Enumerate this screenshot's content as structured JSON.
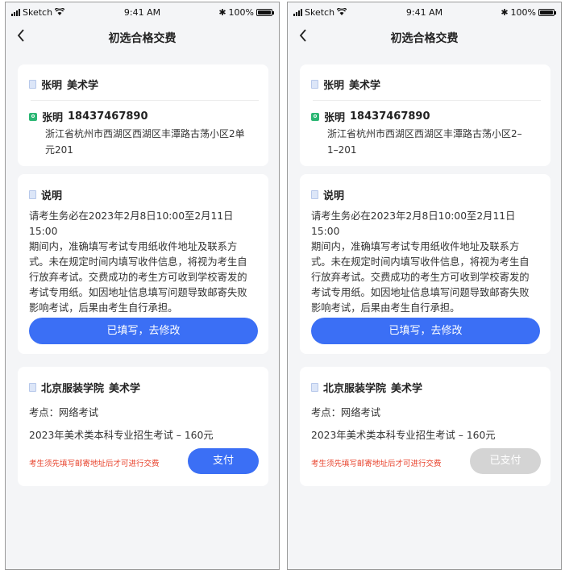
{
  "colors": {
    "accent": "#3b6ff5",
    "warning": "#e8452f",
    "disabled": "#d4d4d4"
  },
  "screens": [
    {
      "status": {
        "carrier": "Sketch",
        "time": "9:41 AM",
        "battery": "100%"
      },
      "nav": {
        "title": "初选合格交费"
      },
      "school_card": {
        "name": "张明",
        "major": "美术学"
      },
      "contact": {
        "name": "张明",
        "phone": "18437467890",
        "address_line1": "浙江省杭州市西湖区西湖区丰潭路古荡小区2单",
        "address_line2": "元201"
      },
      "notice": {
        "title": "说明",
        "lines": [
          "请考生务必在2023年2月8日10:00至2月11日15:00",
          "期间内，准确填写考试专用纸收件地址及联系方",
          "式。未在规定时间内填写收件信息，将视为考生自",
          "行放弃考试。交费成功的考生方可收到学校寄发的",
          "考试专用纸。如因地址信息填写问题导致邮寄失败",
          "影响考试，后果由考生自行承担。"
        ],
        "button": "已填写，去修改"
      },
      "payment": {
        "school": "北京服装学院",
        "major": "美术学",
        "exam_site": "考点：网络考试",
        "exam_fee": "2023年美术类本科专业招生考试 – 160元",
        "warning": "考生须先填写邮寄地址后才可进行交费",
        "pay_button": "支付"
      }
    },
    {
      "status": {
        "carrier": "Sketch",
        "time": "9:41 AM",
        "battery": "100%"
      },
      "nav": {
        "title": "初选合格交费"
      },
      "school_card": {
        "name": "张明",
        "major": "美术学"
      },
      "contact": {
        "name": "张明",
        "phone": "18437467890",
        "address_line1": "浙江省杭州市西湖区西湖区丰潭路古荡小区2–",
        "address_line2": "1–201"
      },
      "notice": {
        "title": "说明",
        "lines": [
          "请考生务必在2023年2月8日10:00至2月11日15:00",
          "期间内，准确填写考试专用纸收件地址及联系方",
          "式。未在规定时间内填写收件信息，将视为考生自",
          "行放弃考试。交费成功的考生方可收到学校寄发的",
          "考试专用纸。如因地址信息填写问题导致邮寄失败",
          "影响考试，后果由考生自行承担。"
        ],
        "button": "已填写，去修改"
      },
      "payment": {
        "school": "北京服装学院",
        "major": "美术学",
        "exam_site": "考点：网络考试",
        "exam_fee": "2023年美术类本科专业招生考试 – 160元",
        "warning": "考生须先填写邮寄地址后才可进行交费",
        "pay_button": "已支付"
      }
    }
  ]
}
